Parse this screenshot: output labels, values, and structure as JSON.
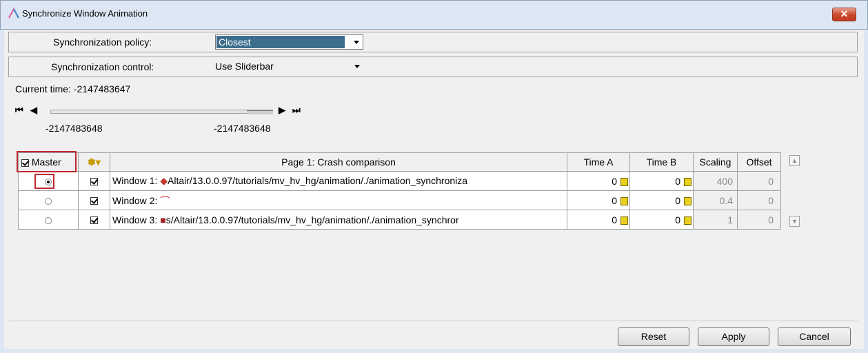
{
  "window": {
    "title": "Synchronize Window Animation",
    "close": "✕"
  },
  "policy": {
    "label": "Synchronization policy:",
    "value": "Closest"
  },
  "control": {
    "label": "Synchronization control:",
    "value": "Use Sliderbar"
  },
  "current_time": "Current time:  -2147483647",
  "transport": {
    "first": "⏮",
    "prev": "◀",
    "next": "▶",
    "last": "⏭"
  },
  "slider": {
    "min_label": "-2147483648",
    "max_label": "-2147483648"
  },
  "table": {
    "headers": {
      "master": "Master",
      "page": "Page 1: Crash comparison",
      "time_a": "Time A",
      "time_b": "Time B",
      "scaling": "Scaling",
      "offset": "Offset"
    },
    "rows": [
      {
        "window": "Window 1: ",
        "path": "Altair/13.0.0.97/tutorials/mv_hv_hg/animation/./animation_synchroniza",
        "time_a": "0",
        "time_b": "0",
        "scaling": "400",
        "offset": "0",
        "master": true
      },
      {
        "window": "Window 2: ",
        "path": "",
        "time_a": "0",
        "time_b": "0",
        "scaling": "0.4",
        "offset": "0",
        "master": false
      },
      {
        "window": "Window 3: ",
        "path": "s/Altair/13.0.0.97/tutorials/mv_hv_hg/animation/./animation_synchror",
        "time_a": "0",
        "time_b": "0",
        "scaling": "1",
        "offset": "0",
        "master": false
      }
    ]
  },
  "buttons": {
    "reset": "Reset",
    "apply": "Apply",
    "cancel": "Cancel"
  }
}
